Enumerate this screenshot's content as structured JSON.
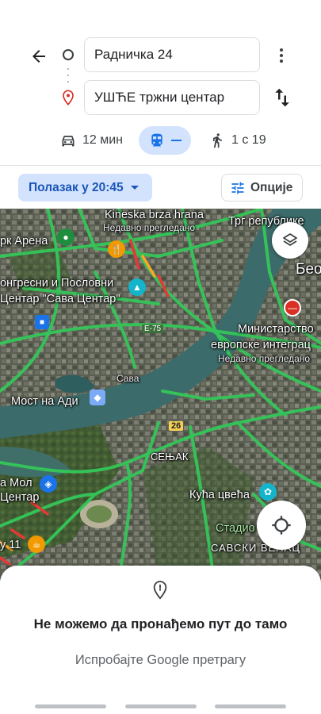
{
  "directions": {
    "origin": "Радничка 24",
    "destination": "УШЋЕ тржни центар",
    "back_icon": "arrow-back-icon",
    "more_icon": "more-vert-icon",
    "swap_icon": "swap-vert-icon"
  },
  "modes": {
    "car": {
      "icon": "car-icon",
      "label": "12 мин"
    },
    "transit": {
      "icon": "train-icon",
      "label": "—",
      "selected": true
    },
    "walk": {
      "icon": "walk-icon",
      "label": "1 с 19"
    }
  },
  "filters": {
    "depart_label": "Полазак у 20:45",
    "options_label": "Опције"
  },
  "map": {
    "labels": {
      "kineska": "Kineska brza hrana",
      "nedavno1": "Недавно прегледано",
      "trg": "Трг републике",
      "arena": "рк Арена",
      "beo": "Бео",
      "kongres1": "онгресни и Пословни",
      "kongres2": "Центар \"Сава Центар\"",
      "ministarstvo1": "Министарство",
      "ministarstvo2": "европске интеграц",
      "nedavno2": "Недавно прегледано",
      "sava": "Сава",
      "most": "Мост на Ади",
      "senjak": "СЕЊАК",
      "mol1": "а Мол",
      "mol2": "Центар",
      "kuca": "Кућа цвећа",
      "stadion": "Стадио",
      "savski": "САВСКИ ВЕНАЦ",
      "u11": "у 11",
      "e75": "E-75",
      "r26": "26"
    },
    "layers_icon": "layers-icon",
    "locate_icon": "my-location-icon"
  },
  "sheet": {
    "pin_icon": "location-pin-icon",
    "title": "Не можемо да пронађемо пут до тамо",
    "link": "Испробајте Google претрагу"
  },
  "colors": {
    "accent": "#1a73e8",
    "chip_bg": "#d3e3fd",
    "traffic_green": "#34c759",
    "traffic_red": "#e53935"
  }
}
